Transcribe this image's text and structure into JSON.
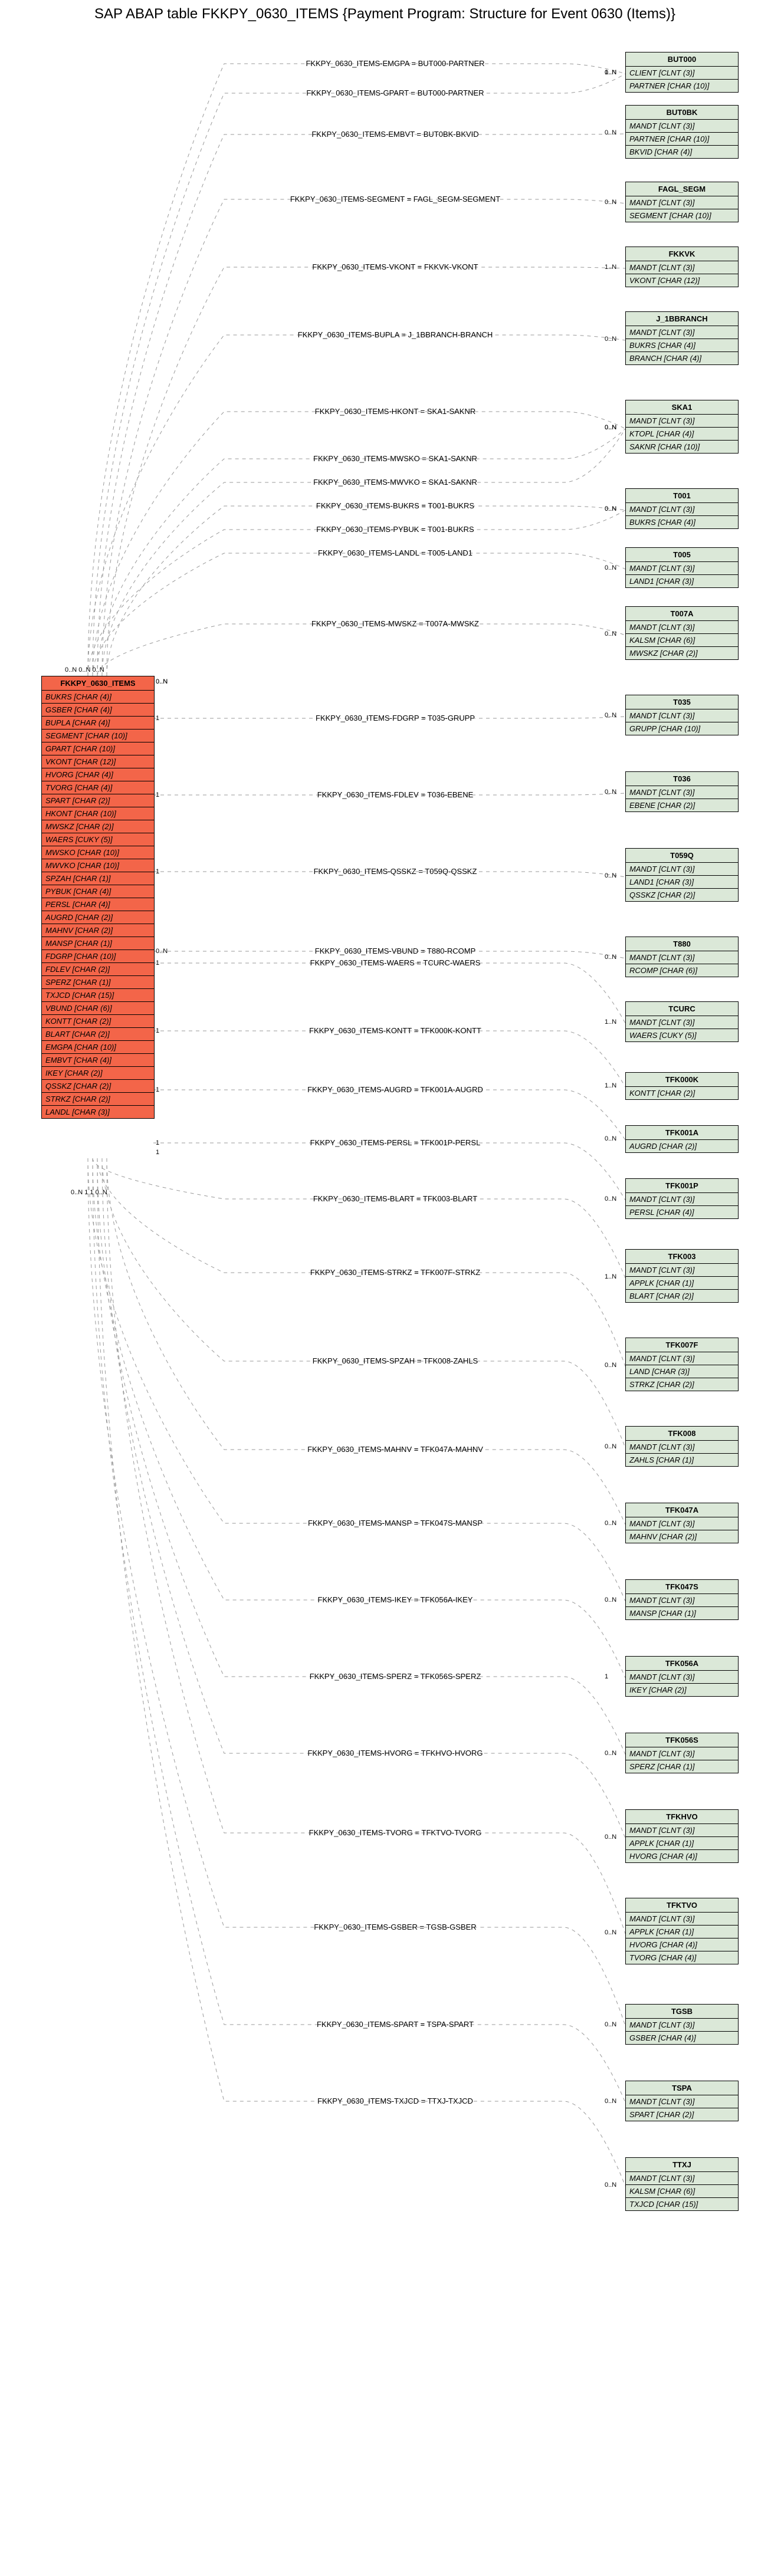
{
  "title": "SAP ABAP table FKKPY_0630_ITEMS {Payment Program: Structure for Event 0630 (Items)}",
  "main": {
    "name": "FKKPY_0630_ITEMS",
    "fields": [
      "BUKRS [CHAR (4)]",
      "GSBER [CHAR (4)]",
      "BUPLA [CHAR (4)]",
      "SEGMENT [CHAR (10)]",
      "GPART [CHAR (10)]",
      "VKONT [CHAR (12)]",
      "HVORG [CHAR (4)]",
      "TVORG [CHAR (4)]",
      "SPART [CHAR (2)]",
      "HKONT [CHAR (10)]",
      "MWSKZ [CHAR (2)]",
      "WAERS [CUKY (5)]",
      "MWSKO [CHAR (10)]",
      "MWVKO [CHAR (10)]",
      "SPZAH [CHAR (1)]",
      "PYBUK [CHAR (4)]",
      "PERSL [CHAR (4)]",
      "AUGRD [CHAR (2)]",
      "MAHNV [CHAR (2)]",
      "MANSP [CHAR (1)]",
      "FDGRP [CHAR (10)]",
      "FDLEV [CHAR (2)]",
      "SPERZ [CHAR (1)]",
      "TXJCD [CHAR (15)]",
      "VBUND [CHAR (6)]",
      "KONTT [CHAR (2)]",
      "BLART [CHAR (2)]",
      "EMGPA [CHAR (10)]",
      "EMBVT [CHAR (4)]",
      "IKEY [CHAR (2)]",
      "QSSKZ [CHAR (2)]",
      "STRKZ [CHAR (2)]",
      "LANDL [CHAR (3)]"
    ]
  },
  "targets": [
    {
      "name": "BUT000",
      "fields": [
        "CLIENT [CLNT (3)]",
        "PARTNER [CHAR (10)]"
      ]
    },
    {
      "name": "BUT0BK",
      "fields": [
        "MANDT [CLNT (3)]",
        "PARTNER [CHAR (10)]",
        "BKVID [CHAR (4)]"
      ]
    },
    {
      "name": "FAGL_SEGM",
      "fields": [
        "MANDT [CLNT (3)]",
        "SEGMENT [CHAR (10)]"
      ]
    },
    {
      "name": "FKKVK",
      "fields": [
        "MANDT [CLNT (3)]",
        "VKONT [CHAR (12)]"
      ]
    },
    {
      "name": "J_1BBRANCH",
      "fields": [
        "MANDT [CLNT (3)]",
        "BUKRS [CHAR (4)]",
        "BRANCH [CHAR (4)]"
      ]
    },
    {
      "name": "SKA1",
      "fields": [
        "MANDT [CLNT (3)]",
        "KTOPL [CHAR (4)]",
        "SAKNR [CHAR (10)]"
      ]
    },
    {
      "name": "T001",
      "fields": [
        "MANDT [CLNT (3)]",
        "BUKRS [CHAR (4)]"
      ]
    },
    {
      "name": "T005",
      "fields": [
        "MANDT [CLNT (3)]",
        "LAND1 [CHAR (3)]"
      ]
    },
    {
      "name": "T007A",
      "fields": [
        "MANDT [CLNT (3)]",
        "KALSM [CHAR (6)]",
        "MWSKZ [CHAR (2)]"
      ]
    },
    {
      "name": "T035",
      "fields": [
        "MANDT [CLNT (3)]",
        "GRUPP [CHAR (10)]"
      ]
    },
    {
      "name": "T036",
      "fields": [
        "MANDT [CLNT (3)]",
        "EBENE [CHAR (2)]"
      ]
    },
    {
      "name": "T059Q",
      "fields": [
        "MANDT [CLNT (3)]",
        "LAND1 [CHAR (3)]",
        "QSSKZ [CHAR (2)]"
      ]
    },
    {
      "name": "T880",
      "fields": [
        "MANDT [CLNT (3)]",
        "RCOMP [CHAR (6)]"
      ]
    },
    {
      "name": "TCURC",
      "fields": [
        "MANDT [CLNT (3)]",
        "WAERS [CUKY (5)]"
      ]
    },
    {
      "name": "TFK000K",
      "fields": [
        "KONTT [CHAR (2)]"
      ]
    },
    {
      "name": "TFK001A",
      "fields": [
        "AUGRD [CHAR (2)]"
      ]
    },
    {
      "name": "TFK001P",
      "fields": [
        "MANDT [CLNT (3)]",
        "PERSL [CHAR (4)]"
      ]
    },
    {
      "name": "TFK003",
      "fields": [
        "MANDT [CLNT (3)]",
        "APPLK [CHAR (1)]",
        "BLART [CHAR (2)]"
      ]
    },
    {
      "name": "TFK007F",
      "fields": [
        "MANDT [CLNT (3)]",
        "LAND [CHAR (3)]",
        "STRKZ [CHAR (2)]"
      ]
    },
    {
      "name": "TFK008",
      "fields": [
        "MANDT [CLNT (3)]",
        "ZAHLS [CHAR (1)]"
      ]
    },
    {
      "name": "TFK047A",
      "fields": [
        "MANDT [CLNT (3)]",
        "MAHNV [CHAR (2)]"
      ]
    },
    {
      "name": "TFK047S",
      "fields": [
        "MANDT [CLNT (3)]",
        "MANSP [CHAR (1)]"
      ]
    },
    {
      "name": "TFK056A",
      "fields": [
        "MANDT [CLNT (3)]",
        "IKEY [CHAR (2)]"
      ]
    },
    {
      "name": "TFK056S",
      "fields": [
        "MANDT [CLNT (3)]",
        "SPERZ [CHAR (1)]"
      ]
    },
    {
      "name": "TFKHVO",
      "fields": [
        "MANDT [CLNT (3)]",
        "APPLK [CHAR (1)]",
        "HVORG [CHAR (4)]"
      ]
    },
    {
      "name": "TFKTVO",
      "fields": [
        "MANDT [CLNT (3)]",
        "APPLK [CHAR (1)]",
        "HVORG [CHAR (4)]",
        "TVORG [CHAR (4)]"
      ]
    },
    {
      "name": "TGSB",
      "fields": [
        "MANDT [CLNT (3)]",
        "GSBER [CHAR (4)]"
      ]
    },
    {
      "name": "TSPA",
      "fields": [
        "MANDT [CLNT (3)]",
        "SPART [CHAR (2)]"
      ]
    },
    {
      "name": "TTXJ",
      "fields": [
        "MANDT [CLNT (3)]",
        "KALSM [CHAR (6)]",
        "TXJCD [CHAR (15)]"
      ]
    }
  ],
  "edges": [
    {
      "label": "FKKPY_0630_ITEMS-EMGPA = BUT000-PARTNER",
      "cardL": "0..N",
      "cardR": "0..N"
    },
    {
      "label": "FKKPY_0630_ITEMS-GPART = BUT000-PARTNER",
      "cardL": "",
      "cardR": "1..N"
    },
    {
      "label": "FKKPY_0630_ITEMS-EMBVT = BUT0BK-BKVID",
      "cardL": "",
      "cardR": "0..N"
    },
    {
      "label": "FKKPY_0630_ITEMS-SEGMENT = FAGL_SEGM-SEGMENT",
      "cardL": "",
      "cardR": "0..N"
    },
    {
      "label": "FKKPY_0630_ITEMS-VKONT = FKKVK-VKONT",
      "cardL": "",
      "cardR": "1..N"
    },
    {
      "label": "FKKPY_0630_ITEMS-BUPLA = J_1BBRANCH-BRANCH",
      "cardL": "",
      "cardR": "0..N"
    },
    {
      "label": "FKKPY_0630_ITEMS-HKONT = SKA1-SAKNR",
      "cardL": "",
      "cardR": "0..N"
    },
    {
      "label": "FKKPY_0630_ITEMS-MWSKO = SKA1-SAKNR",
      "cardL": "",
      "cardR": "0..N"
    },
    {
      "label": "FKKPY_0630_ITEMS-MWVKO = SKA1-SAKNR",
      "cardL": "",
      "cardR": "0..N"
    },
    {
      "label": "FKKPY_0630_ITEMS-BUKRS = T001-BUKRS",
      "cardL": "",
      "cardR": "0..N"
    },
    {
      "label": "FKKPY_0630_ITEMS-PYBUK = T001-BUKRS",
      "cardL": "",
      "cardR": "0..N"
    },
    {
      "label": "FKKPY_0630_ITEMS-LANDL = T005-LAND1",
      "cardL": "",
      "cardR": "0..N"
    },
    {
      "label": "FKKPY_0630_ITEMS-MWSKZ = T007A-MWSKZ",
      "cardL": "0..N",
      "cardR": "0..N"
    },
    {
      "label": "FKKPY_0630_ITEMS-FDGRP = T035-GRUPP",
      "cardL": "1",
      "cardR": "0..N"
    },
    {
      "label": "FKKPY_0630_ITEMS-FDLEV = T036-EBENE",
      "cardL": "1",
      "cardR": "0..N"
    },
    {
      "label": "FKKPY_0630_ITEMS-QSSKZ = T059Q-QSSKZ",
      "cardL": "1",
      "cardR": "0..N"
    },
    {
      "label": "FKKPY_0630_ITEMS-VBUND = T880-RCOMP",
      "cardL": "0..N",
      "cardR": "0..N"
    },
    {
      "label": "FKKPY_0630_ITEMS-WAERS = TCURC-WAERS",
      "cardL": "1",
      "cardR": "1..N"
    },
    {
      "label": "FKKPY_0630_ITEMS-KONTT = TFK000K-KONTT",
      "cardL": "1",
      "cardR": "1..N"
    },
    {
      "label": "FKKPY_0630_ITEMS-AUGRD = TFK001A-AUGRD",
      "cardL": "1",
      "cardR": "0..N"
    },
    {
      "label": "FKKPY_0630_ITEMS-PERSL = TFK001P-PERSL",
      "cardL": "1",
      "cardR": "0..N"
    },
    {
      "label": "FKKPY_0630_ITEMS-BLART = TFK003-BLART",
      "cardL": "1",
      "cardR": "1..N"
    },
    {
      "label": "FKKPY_0630_ITEMS-STRKZ = TFK007F-STRKZ",
      "cardL": "",
      "cardR": "0..N"
    },
    {
      "label": "FKKPY_0630_ITEMS-SPZAH = TFK008-ZAHLS",
      "cardL": "",
      "cardR": "0..N"
    },
    {
      "label": "FKKPY_0630_ITEMS-MAHNV = TFK047A-MAHNV",
      "cardL": "",
      "cardR": "0..N"
    },
    {
      "label": "FKKPY_0630_ITEMS-MANSP = TFK047S-MANSP",
      "cardL": "",
      "cardR": "0..N"
    },
    {
      "label": "FKKPY_0630_ITEMS-IKEY = TFK056A-IKEY",
      "cardL": "",
      "cardR": "1"
    },
    {
      "label": "FKKPY_0630_ITEMS-SPERZ = TFK056S-SPERZ",
      "cardL": "",
      "cardR": "0..N"
    },
    {
      "label": "FKKPY_0630_ITEMS-HVORG = TFKHVO-HVORG",
      "cardL": "",
      "cardR": "0..N"
    },
    {
      "label": "FKKPY_0630_ITEMS-TVORG = TFKTVO-TVORG",
      "cardL": "",
      "cardR": "0..N"
    },
    {
      "label": "FKKPY_0630_ITEMS-GSBER = TGSB-GSBER",
      "cardL": "",
      "cardR": "0..N"
    },
    {
      "label": "FKKPY_0630_ITEMS-SPART = TSPA-SPART",
      "cardL": "",
      "cardR": "0..N"
    },
    {
      "label": "FKKPY_0630_ITEMS-TXJCD = TTXJ-TXJCD",
      "cardL": "",
      "cardR": "0..N"
    }
  ],
  "mainCardTop": "0..N 0..N 0..N",
  "mainCardBot": "0..N 1 1 0..N"
}
